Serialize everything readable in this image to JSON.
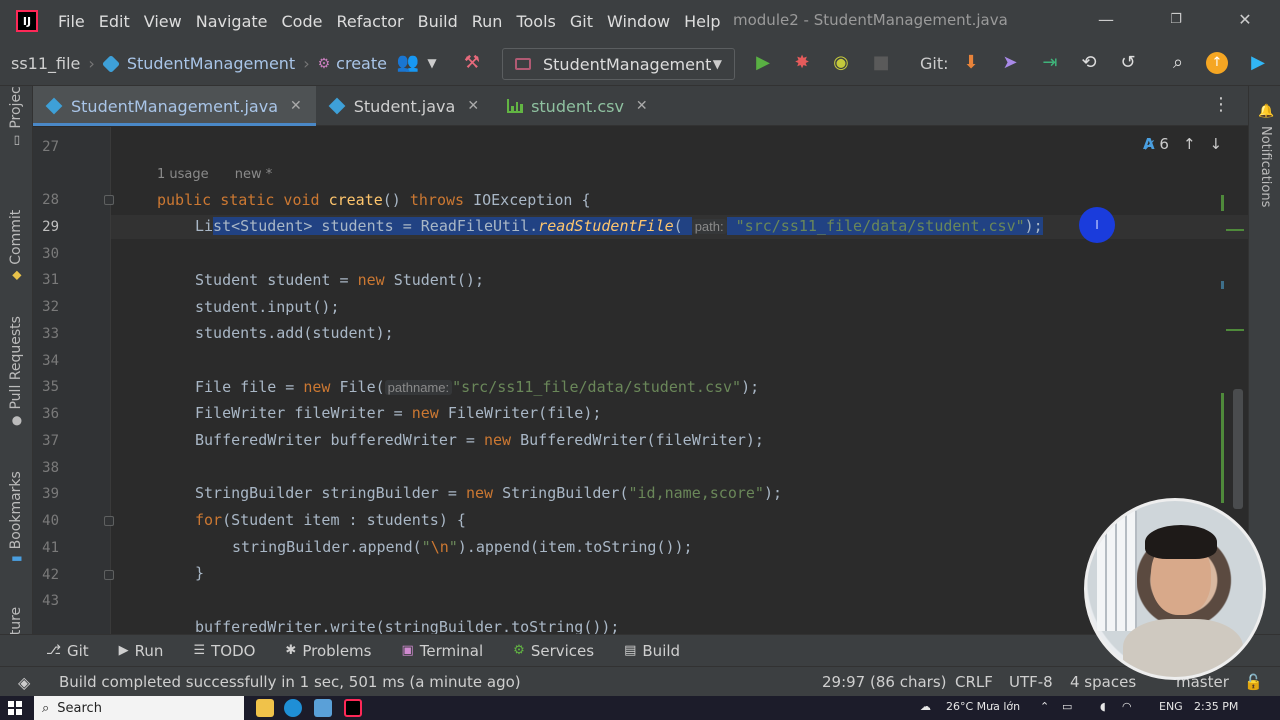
{
  "menubar": {
    "items": [
      "File",
      "Edit",
      "View",
      "Navigate",
      "Code",
      "Refactor",
      "Build",
      "Run",
      "Tools",
      "Git",
      "Window",
      "Help"
    ],
    "title": "module2 - StudentManagement.java",
    "controls": {
      "minimize": "—",
      "restore": "❐",
      "close": "✕"
    }
  },
  "toolbar": {
    "breadcrumb": [
      "ss11_file",
      "StudentManagement",
      "create"
    ],
    "run_config": "StudentManagement",
    "git_label": "Git:",
    "icons": [
      "people-icon",
      "hammer-icon",
      "run-icon",
      "debug-icon",
      "coverage-icon",
      "stop-icon",
      "update-icon",
      "commit-icon",
      "push-icon",
      "history-icon",
      "rollback-icon",
      "search-icon",
      "update-available-icon",
      "logo-icon"
    ]
  },
  "left_strip": {
    "tabs": [
      "Project",
      "Commit",
      "Pull Requests",
      "Bookmarks",
      "Structure"
    ]
  },
  "right_strip": {
    "tabs": [
      "Notifications"
    ]
  },
  "tabs": [
    {
      "label": "StudentManagement.java",
      "icon": "class-icon",
      "active": true
    },
    {
      "label": "Student.java",
      "icon": "class-icon",
      "active": false
    },
    {
      "label": "student.csv",
      "icon": "csv-icon",
      "active": false
    }
  ],
  "editor": {
    "usage_hint": "1 usage",
    "new_hint": "new *",
    "inspection_count": "6",
    "line_numbers": [
      "27",
      "28",
      "29",
      "30",
      "31",
      "32",
      "33",
      "34",
      "35",
      "36",
      "37",
      "38",
      "39",
      "40",
      "41",
      "42",
      "43"
    ],
    "lines": {
      "l28": {
        "kw1": "public static void ",
        "fn": "create",
        "rest": "() ",
        "kw2": "throws ",
        "tail": "IOException {"
      },
      "l29": {
        "pre": "List<Student> students = ReadFileUtil.",
        "fn": "readStudentFile",
        "paren": "(",
        "hint": "path:",
        "str": "\"src/ss11_file/data/student.csv\"",
        "tail": ");"
      },
      "l31": {
        "pre": "Student student = ",
        "kw": "new ",
        "tail": "Student();"
      },
      "l32": {
        "text": "student.input();"
      },
      "l33": {
        "text": "students.add(student);"
      },
      "l35": {
        "pre": "File file = ",
        "kw": "new ",
        "mid": "File(",
        "hint": "pathname:",
        "str": "\"src/ss11_file/data/student.csv\"",
        "tail": ");"
      },
      "l36": {
        "pre": "FileWriter fileWriter = ",
        "kw": "new ",
        "tail": "FileWriter(file);"
      },
      "l37": {
        "pre": "BufferedWriter bufferedWriter = ",
        "kw": "new ",
        "tail": "BufferedWriter(fileWriter);"
      },
      "l39": {
        "pre": "StringBuilder stringBuilder = ",
        "kw": "new ",
        "mid": "StringBuilder(",
        "str": "\"id,name,score\"",
        "tail": ");"
      },
      "l40": {
        "kw": "for",
        "tail": "(Student item : students) {"
      },
      "l41": {
        "pre": "stringBuilder.append(",
        "str1": "\"",
        "esc": "\\n",
        "str2": "\"",
        "tail": ").append(item.toString());"
      },
      "l42": {
        "text": "}"
      },
      "l44": {
        "text": "bufferedWriter.write(stringBuilder.toString());"
      }
    }
  },
  "bottom_tabs": [
    {
      "label": "Git",
      "glyph": "⎇"
    },
    {
      "label": "Run",
      "glyph": "▶"
    },
    {
      "label": "TODO",
      "glyph": "☰"
    },
    {
      "label": "Problems",
      "glyph": "✱"
    },
    {
      "label": "Terminal",
      "glyph": "▣"
    },
    {
      "label": "Services",
      "glyph": "⚙"
    },
    {
      "label": "Build",
      "glyph": "▤"
    }
  ],
  "statusbar": {
    "message": "Build completed successfully in 1 sec, 501 ms (a minute ago)",
    "position": "29:97 (86 chars)",
    "line_sep": "CRLF",
    "encoding": "UTF-8",
    "indent": "4 spaces",
    "branch": "master"
  },
  "taskbar": {
    "search_placeholder": "Search",
    "weather": "26°C  Mưa lớn",
    "language": "ENG",
    "time": "2:35 PM"
  },
  "colors": {
    "accent": "#4a88c7",
    "selection": "#214283",
    "keyword": "#cc7832",
    "string": "#6a8759",
    "function": "#ffc66d"
  }
}
